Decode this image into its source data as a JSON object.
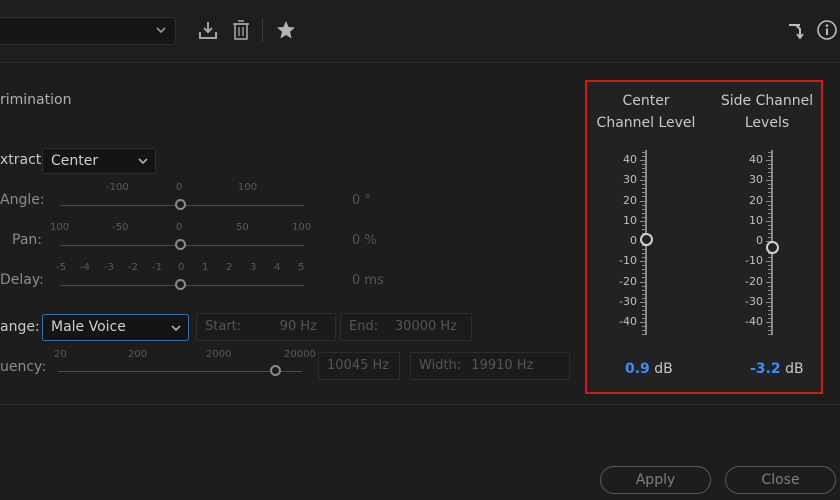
{
  "toolbar": {
    "preset_value": "",
    "icons": [
      "save-preset-icon",
      "delete-preset-icon",
      "favorite-star-icon",
      "routing-icon",
      "info-icon"
    ]
  },
  "section": {
    "title": "rimination"
  },
  "controls": {
    "extract_label": "xtract:",
    "extract_value": "Center",
    "angle_label": "Angle:",
    "angle_ticks": [
      "-100",
      "0",
      "100"
    ],
    "angle_value": "0 °",
    "pan_label": "Pan:",
    "pan_ticks": [
      "100",
      "-50",
      "0",
      "50",
      "100"
    ],
    "pan_value": "0 %",
    "delay_label": "Delay:",
    "delay_ticks": [
      "-5",
      "-4",
      "-3",
      "-2",
      "-1",
      "0",
      "1",
      "2",
      "3",
      "4",
      "5"
    ],
    "delay_value": "0 ms",
    "range_label": "ange:",
    "range_value": "Male Voice",
    "start_label": "Start:",
    "start_value": "90 Hz",
    "end_label": "End:",
    "end_value": "30000 Hz",
    "freq_label": "uency:",
    "freq_ticks": [
      "20",
      "200",
      "2000",
      "20000"
    ],
    "freq_value": "10045 Hz",
    "width_label": "Width:",
    "width_value": "19910 Hz"
  },
  "meters": {
    "center": {
      "title_line1": "Center",
      "title_line2": "Channel Level",
      "value": "0.9",
      "unit": "dB",
      "level_db": 0.9
    },
    "side": {
      "title_line1": "Side Channel",
      "title_line2": "Levels",
      "value": "-3.2",
      "unit": "dB",
      "level_db": -3.2
    },
    "scale": [
      "40",
      "30",
      "20",
      "10",
      "0",
      "-10",
      "-20",
      "-30",
      "-40"
    ]
  },
  "buttons": {
    "apply": "Apply",
    "close": "Close"
  },
  "colors": {
    "accent": "#3d8bff",
    "highlight_border": "#d41919"
  }
}
